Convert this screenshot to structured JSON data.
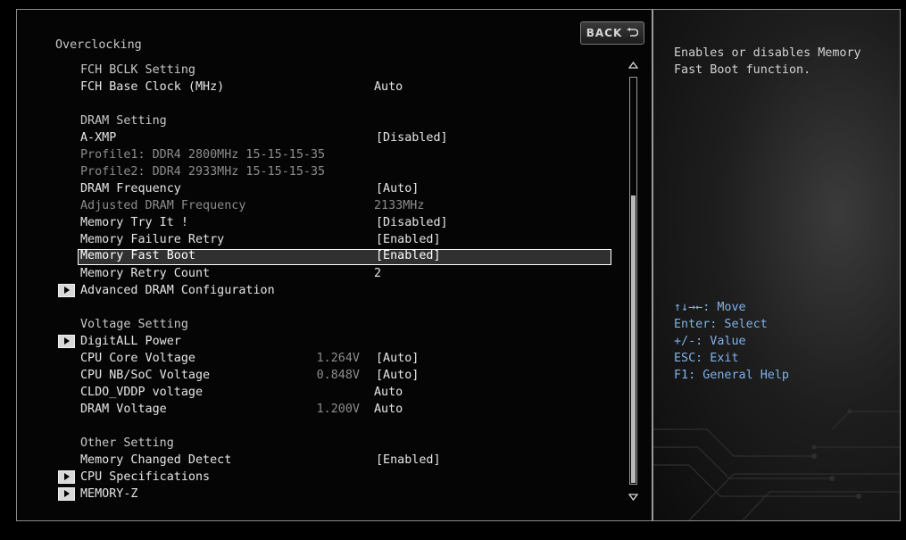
{
  "page": {
    "section_title": "Overclocking",
    "back_label": "BACK"
  },
  "settings": {
    "fch_heading": "FCH BCLK Setting",
    "fch_base_clock": {
      "label": "FCH Base Clock (MHz)",
      "value": "Auto"
    },
    "dram_heading": "DRAM Setting",
    "a_xmp": {
      "label": "A-XMP",
      "value": "[Disabled]"
    },
    "profile1": {
      "label": "Profile1: DDR4 2800MHz 15-15-15-35"
    },
    "profile2": {
      "label": "Profile2: DDR4 2933MHz 15-15-15-35"
    },
    "dram_frequency": {
      "label": "DRAM Frequency",
      "value": "[Auto]"
    },
    "adjusted_dram_frequency": {
      "label": "Adjusted DRAM Frequency",
      "value": "2133MHz"
    },
    "memory_try_it": {
      "label": "Memory Try It !",
      "value": "[Disabled]"
    },
    "memory_failure_retry": {
      "label": "Memory Failure Retry",
      "value": "[Enabled]"
    },
    "memory_fast_boot": {
      "label": "Memory Fast Boot",
      "value": "[Enabled]"
    },
    "memory_retry_count": {
      "label": "Memory Retry Count",
      "value": "2"
    },
    "advanced_dram_configuration": {
      "label": "Advanced DRAM Configuration"
    },
    "voltage_heading": "Voltage Setting",
    "digitall_power": {
      "label": "DigitALL Power"
    },
    "cpu_core_voltage": {
      "label": "CPU Core Voltage",
      "reading": "1.264V",
      "value": "[Auto]"
    },
    "cpu_nb_soc_voltage": {
      "label": "CPU NB/SoC Voltage",
      "reading": "0.848V",
      "value": "[Auto]"
    },
    "cldo_vddp_voltage": {
      "label": "CLDO_VDDP voltage",
      "value": "Auto"
    },
    "dram_voltage": {
      "label": "DRAM Voltage",
      "reading": "1.200V",
      "value": "Auto"
    },
    "other_heading": "Other Setting",
    "memory_changed_detect": {
      "label": "Memory Changed Detect",
      "value": "[Enabled]"
    },
    "cpu_specifications": {
      "label": "CPU Specifications"
    },
    "memory_z": {
      "label": "MEMORY-Z"
    }
  },
  "help": {
    "description_line1": "Enables or disables Memory",
    "description_line2": "Fast Boot function.",
    "keys": {
      "move": "↑↓→←: Move",
      "select": "Enter: Select",
      "value": "+/-: Value",
      "exit": "ESC: Exit",
      "general_help": "F1: General Help"
    }
  },
  "scrollbar": {
    "visible_fraction": 0.71
  }
}
